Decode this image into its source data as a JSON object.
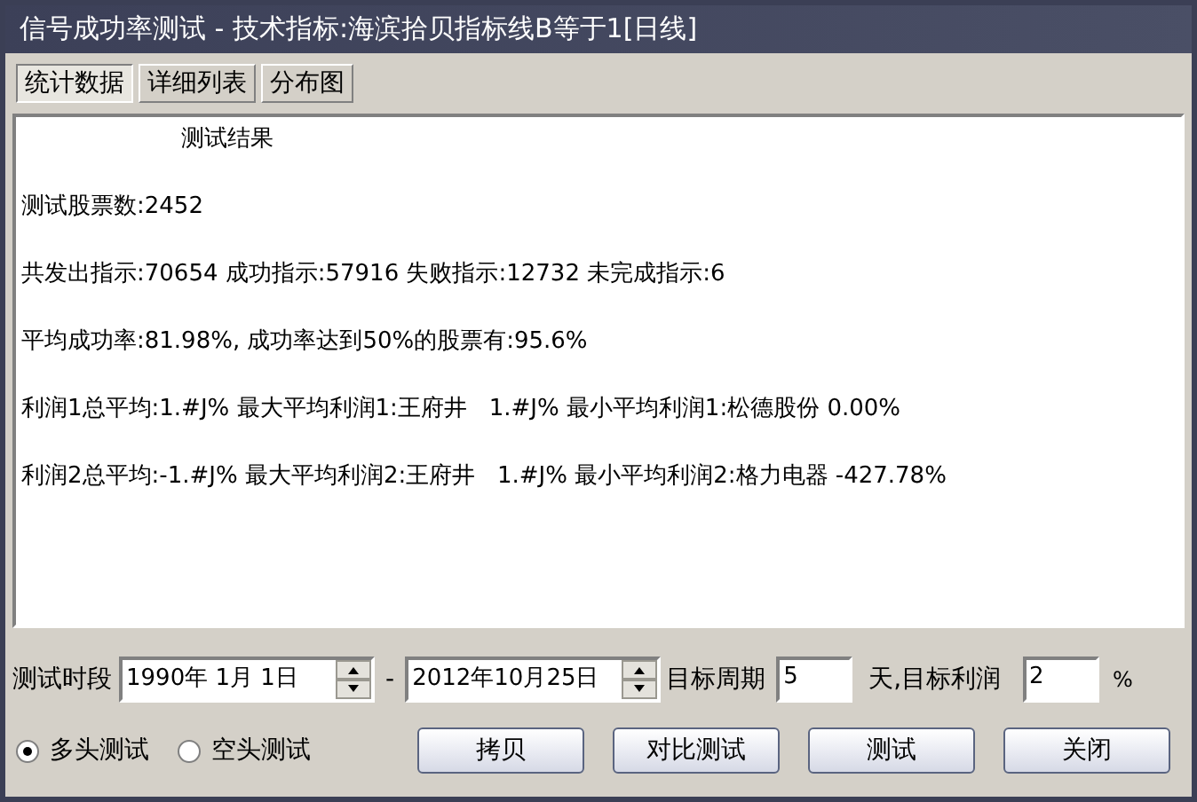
{
  "window": {
    "title": "信号成功率测试 - 技术指标:海滨拾贝指标线B等于1[日线]"
  },
  "tabs": [
    {
      "label": "统计数据",
      "selected": true
    },
    {
      "label": "详细列表",
      "selected": false
    },
    {
      "label": "分布图",
      "selected": false
    }
  ],
  "results": {
    "heading": "测试结果",
    "lines": [
      "测试股票数:2452",
      "共发出指示:70654 成功指示:57916 失败指示:12732 未完成指示:6",
      "平均成功率:81.98%, 成功率达到50%的股票有:95.6%",
      "利润1总平均:1.#J% 最大平均利润1:王府井   1.#J% 最小平均利润1:松德股份 0.00%",
      "利润2总平均:-1.#J% 最大平均利润2:王府井   1.#J% 最小平均利润2:格力电器 -427.78%"
    ]
  },
  "period": {
    "label": "测试时段",
    "start": "1990年 1月 1日",
    "separator": "-",
    "end": "2012年10月25日"
  },
  "target": {
    "period_label": "目标周期",
    "period": "5",
    "profit_label": "天,目标利润",
    "profit": "2",
    "percent": "%"
  },
  "modes": [
    {
      "label": "多头测试",
      "selected": true
    },
    {
      "label": "空头测试",
      "selected": false
    }
  ],
  "buttons": [
    "拷贝",
    "对比测试",
    "测试",
    "关闭"
  ]
}
